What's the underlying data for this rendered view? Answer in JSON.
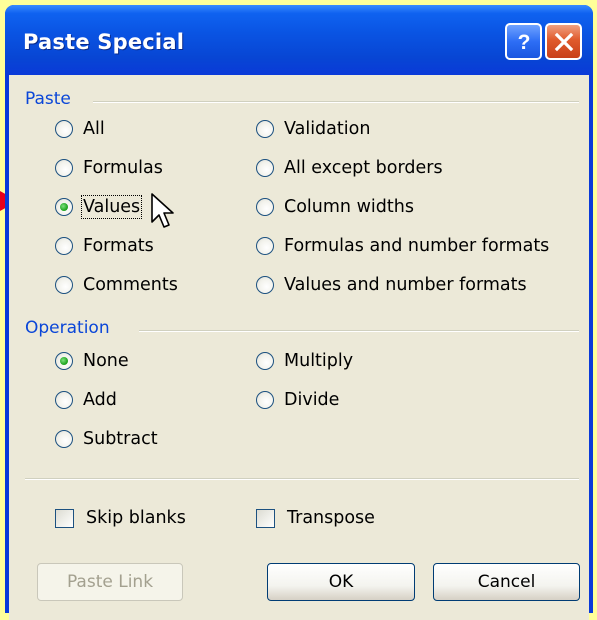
{
  "window": {
    "title": "Paste Special",
    "help_symbol": "?",
    "close_symbol": "×"
  },
  "paste_group": {
    "label": "Paste",
    "left_options": [
      {
        "label": "All",
        "checked": false
      },
      {
        "label": "Formulas",
        "checked": false
      },
      {
        "label": "Values",
        "checked": true
      },
      {
        "label": "Formats",
        "checked": false
      },
      {
        "label": "Comments",
        "checked": false
      }
    ],
    "right_options": [
      {
        "label": "Validation",
        "checked": false
      },
      {
        "label": "All except borders",
        "checked": false
      },
      {
        "label": "Column widths",
        "checked": false
      },
      {
        "label": "Formulas and number formats",
        "checked": false
      },
      {
        "label": "Values and number formats",
        "checked": false
      }
    ]
  },
  "operation_group": {
    "label": "Operation",
    "left_options": [
      {
        "label": "None",
        "checked": true
      },
      {
        "label": "Add",
        "checked": false
      },
      {
        "label": "Subtract",
        "checked": false
      }
    ],
    "right_options": [
      {
        "label": "Multiply",
        "checked": false
      },
      {
        "label": "Divide",
        "checked": false
      }
    ]
  },
  "checkboxes": {
    "skip_blanks": {
      "label": "Skip blanks",
      "checked": false
    },
    "transpose": {
      "label": "Transpose",
      "checked": false
    }
  },
  "buttons": {
    "paste_link": "Paste Link",
    "ok": "OK",
    "cancel": "Cancel"
  },
  "colors": {
    "background": "#ffff99",
    "title_bar": "#0a54e3",
    "dialog_face": "#ece9d8",
    "group_label": "#0a46d8",
    "arrow": "#e8001a"
  },
  "icons": {
    "pointer_arrow": "red-arrow-icon",
    "mouse_cursor": "mouse-pointer-icon"
  }
}
